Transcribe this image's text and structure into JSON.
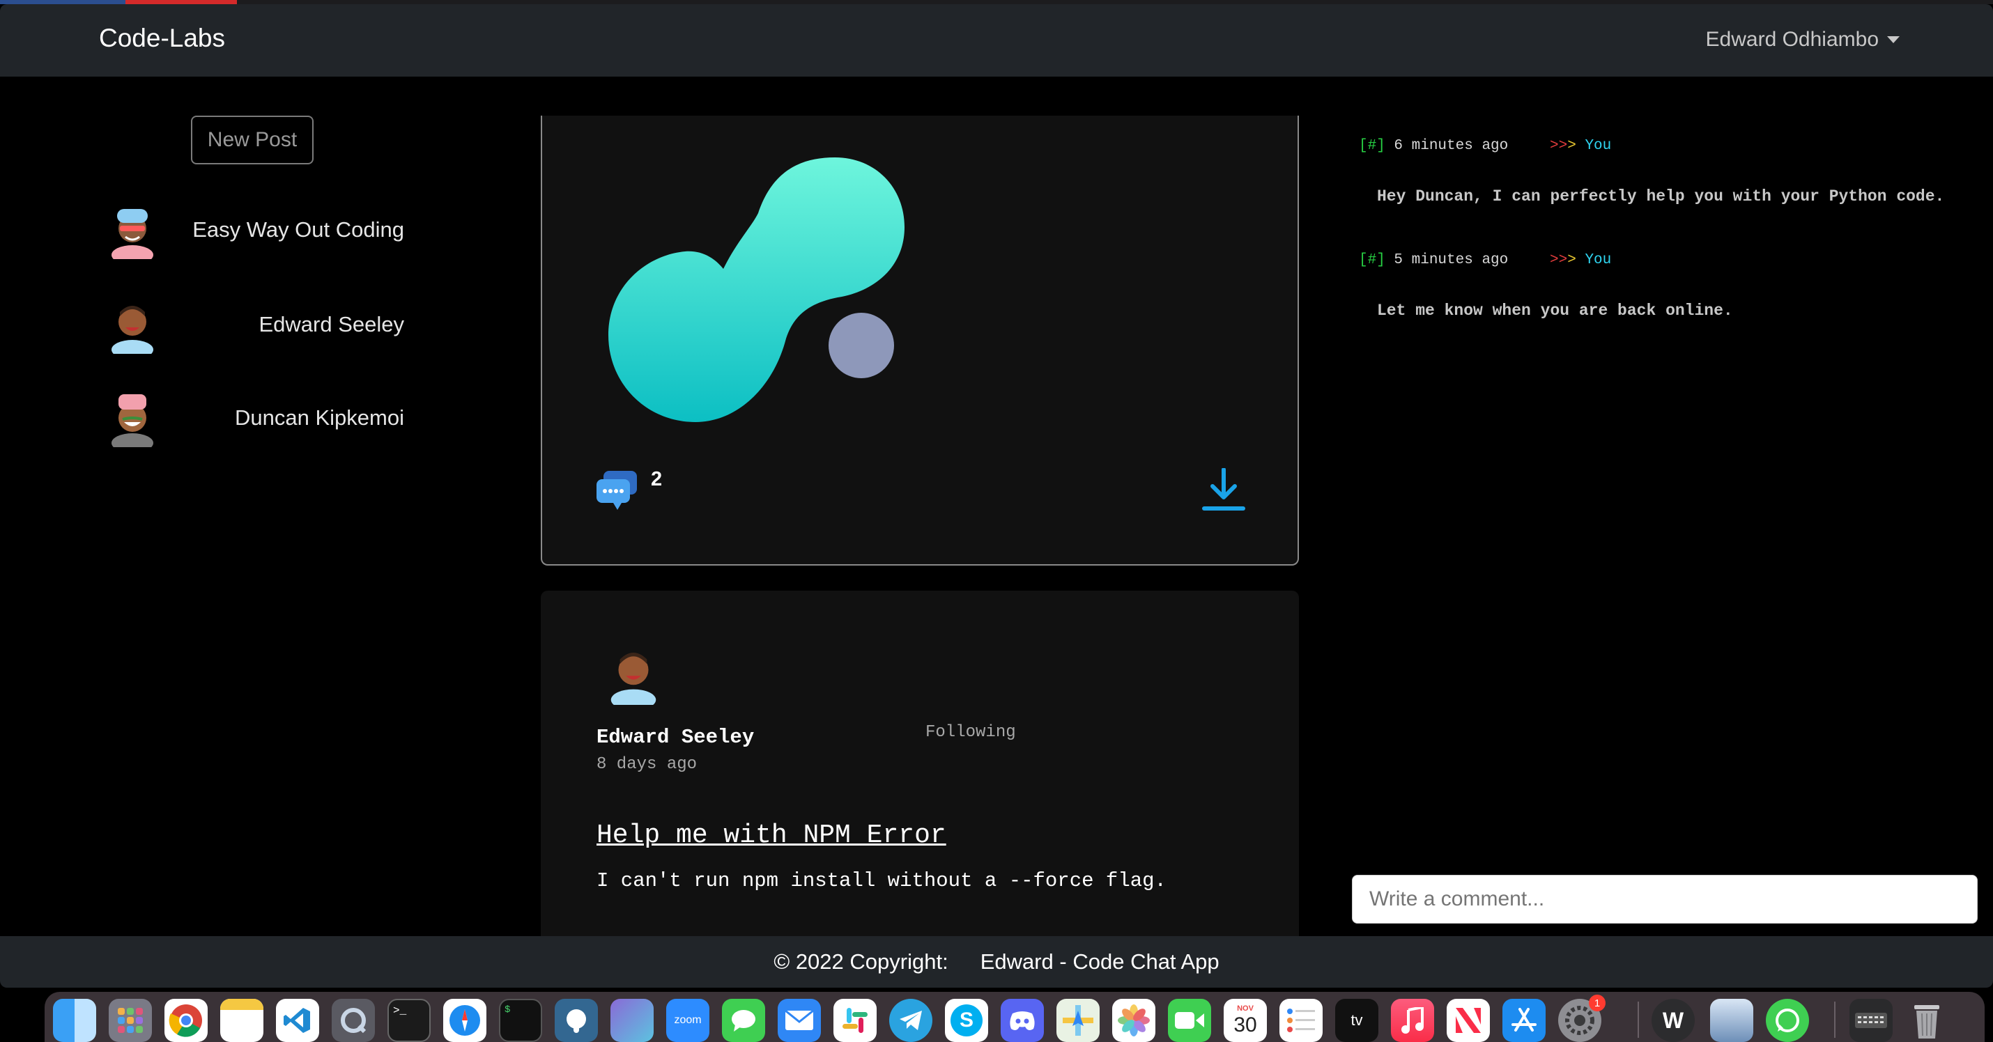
{
  "navbar": {
    "brand": "Code-Labs",
    "user": "Edward Odhiambo"
  },
  "sidebar": {
    "new_post_label": "New Post",
    "contacts": [
      {
        "name": "Easy Way Out Coding"
      },
      {
        "name": "Edward Seeley"
      },
      {
        "name": "Duncan Kipkemoi"
      }
    ]
  },
  "feed": {
    "post1": {
      "comment_count": "2"
    },
    "post2": {
      "author": "Edward Seeley",
      "follow_status": "Following",
      "time": "8 days ago",
      "title": "Help me with NPM Error",
      "body": "I can't run npm install without a --force flag."
    }
  },
  "chat": {
    "messages": [
      {
        "marker": "[#]",
        "time": "6 minutes ago",
        "arrow_prefix": ">>",
        "arrow_suffix": ">",
        "sender": "You",
        "text": "Hey Duncan, I can perfectly help you with your Python code."
      },
      {
        "marker": "[#]",
        "time": "5 minutes ago",
        "arrow_prefix": ">>",
        "arrow_suffix": ">",
        "sender": "You",
        "text": "Let me know when you are back online."
      }
    ],
    "comment_placeholder": "Write a comment..."
  },
  "footer": {
    "copyright": "© 2022 Copyright:",
    "app_name": "Edward - Code Chat App"
  },
  "dock": {
    "calendar_month": "NOV",
    "calendar_day": "30",
    "system_prefs_badge": "1",
    "zoom_label": "zoom",
    "tv_label": "tv"
  },
  "colors": {
    "navbar": "#212529",
    "accent_teal": "#2fd4c9",
    "download_blue": "#1aa3e8",
    "chat_marker_green": "#27d043",
    "chat_you_cyan": "#2fd4f0"
  }
}
